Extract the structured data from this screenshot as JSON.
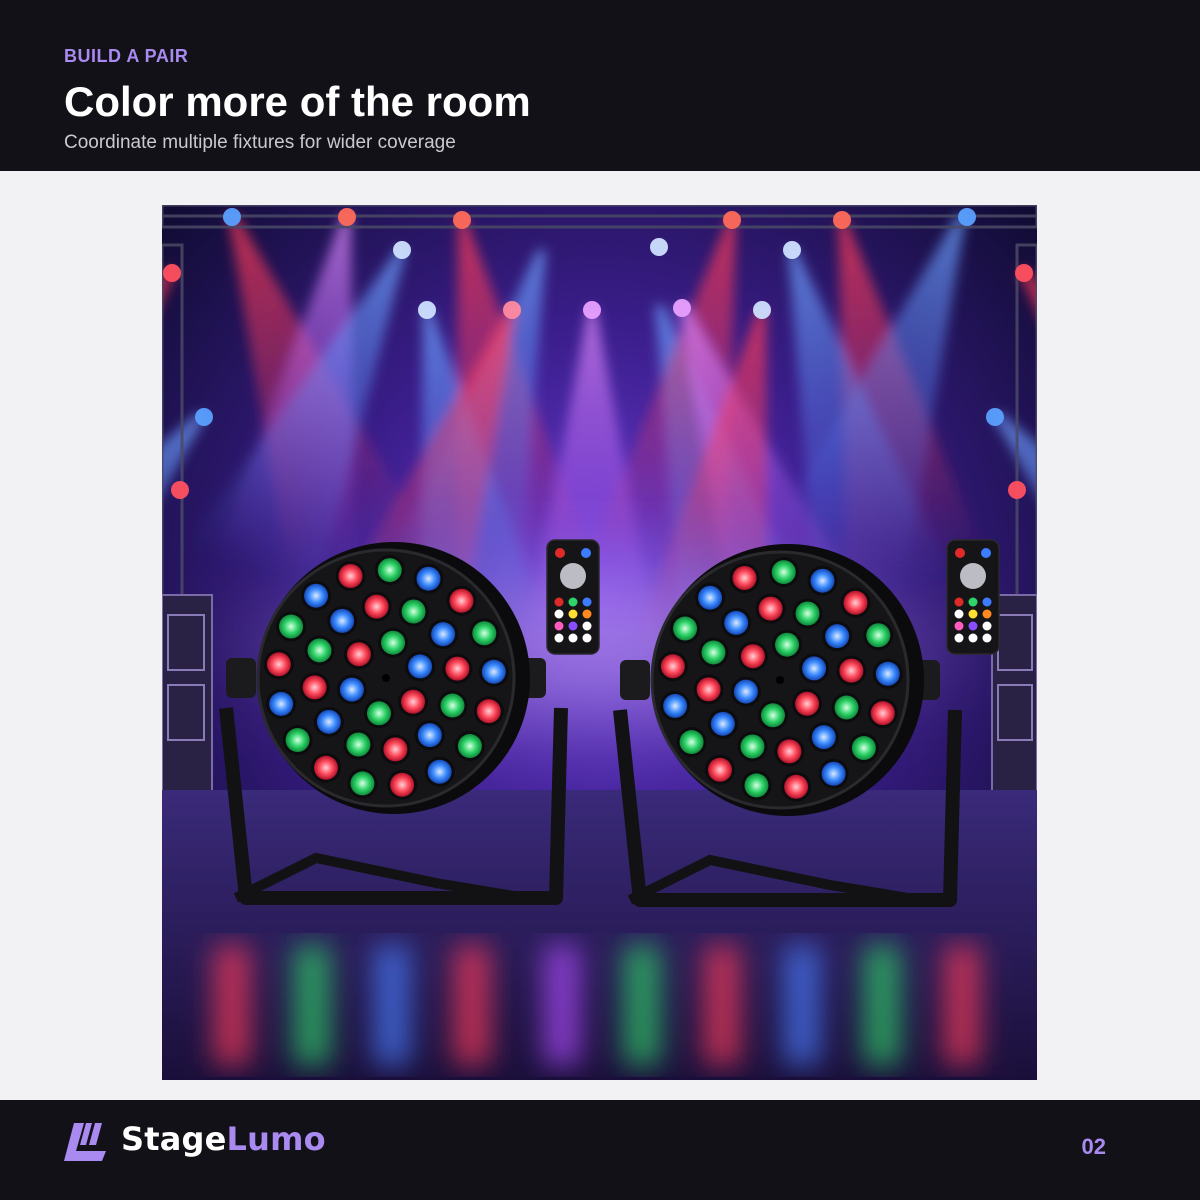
{
  "colors": {
    "accent": "#a98af0",
    "dark": "#121118",
    "background": "#f2f2f4",
    "beam_red": "#ff2a4a",
    "beam_blue": "#3f7bff",
    "beam_magenta": "#d14cff",
    "led_red": "#ff4a5c",
    "led_green": "#2fd36a",
    "led_blue": "#3d8dff"
  },
  "header": {
    "eyebrow": "BUILD A PAIR",
    "title": "Color more of the room",
    "subtitle": "Coordinate multiple fixtures for wider coverage"
  },
  "photo": {
    "subject": "two-par-lights-with-remotes",
    "fixtures": [
      {
        "name": "left",
        "leds": 36
      },
      {
        "name": "right",
        "leds": 36
      }
    ]
  },
  "footer": {
    "brand_part1": "Stage",
    "brand_part2": "Lumo",
    "logo_icon": "stagelumo-logo-icon",
    "page_number": "02"
  }
}
